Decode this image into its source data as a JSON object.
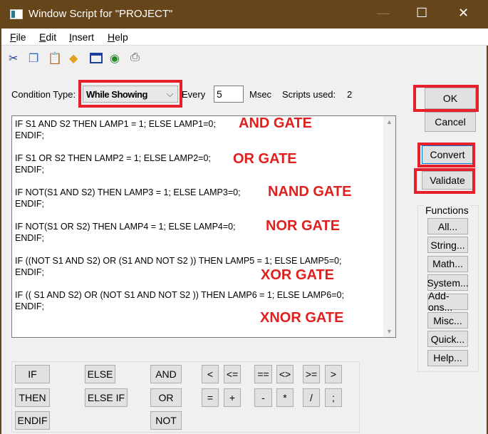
{
  "window": {
    "title": "Window Script for \"PROJECT\"",
    "minimize": "—",
    "maximize": "☐",
    "close": "✕"
  },
  "menu": [
    {
      "label": "File",
      "key": "F",
      "rest": "ile"
    },
    {
      "label": "Edit",
      "key": "E",
      "rest": "dit"
    },
    {
      "label": "Insert",
      "key": "I",
      "rest": "nsert"
    },
    {
      "label": "Help",
      "key": "H",
      "rest": "elp"
    }
  ],
  "toolbar": [
    "cut-icon",
    "copy-icon",
    "paste-icon",
    "tag-icon",
    "window-icon",
    "insert-object-icon",
    "print-icon"
  ],
  "condition": {
    "label": "Condition Type:",
    "value": "While Showing",
    "every_label": "Every",
    "every_value": "5",
    "msec": "Msec",
    "scripts_used_label": "Scripts used:",
    "scripts_used": "2"
  },
  "script_lines": [
    "IF S1 AND S2 THEN LAMP1 = 1; ELSE LAMP1=0;",
    "ENDIF;",
    "",
    "IF S1 OR S2 THEN LAMP2 = 1; ELSE LAMP2=0;",
    "ENDIF;",
    "",
    "IF NOT(S1 AND S2) THEN LAMP3 = 1; ELSE LAMP3=0;",
    "ENDIF;",
    "",
    "IF NOT(S1 OR S2) THEN LAMP4 = 1; ELSE LAMP4=0;",
    "ENDIF;",
    "",
    "IF ((NOT S1 AND S2) OR (S1 AND NOT S2 )) THEN LAMP5 = 1; ELSE LAMP5=0;",
    "ENDIF;",
    "",
    "IF (( S1 AND S2) OR (NOT S1 AND NOT S2 )) THEN LAMP6 = 1; ELSE LAMP6=0;",
    "ENDIF;"
  ],
  "annotations": [
    "AND GATE",
    "OR GATE",
    "NAND GATE",
    "NOR GATE",
    "XOR GATE",
    "XNOR GATE"
  ],
  "buttons": {
    "ok": "OK",
    "cancel": "Cancel",
    "convert": "Convert",
    "validate": "Validate"
  },
  "functions": {
    "label": "Functions",
    "items": [
      "All...",
      "String...",
      "Math...",
      "System...",
      "Add-ons...",
      "Misc...",
      "Quick...",
      "Help..."
    ]
  },
  "keywords": [
    "IF",
    "ELSE",
    "AND",
    "<",
    "<=",
    "==",
    "<>",
    ">=",
    ">",
    "THEN",
    "ELSE IF",
    "OR",
    "=",
    "+",
    "-",
    "*",
    "/",
    ";",
    "ENDIF",
    "NOT"
  ],
  "colors": {
    "titlebar": "#66451a",
    "annotation": "#e0201e"
  }
}
